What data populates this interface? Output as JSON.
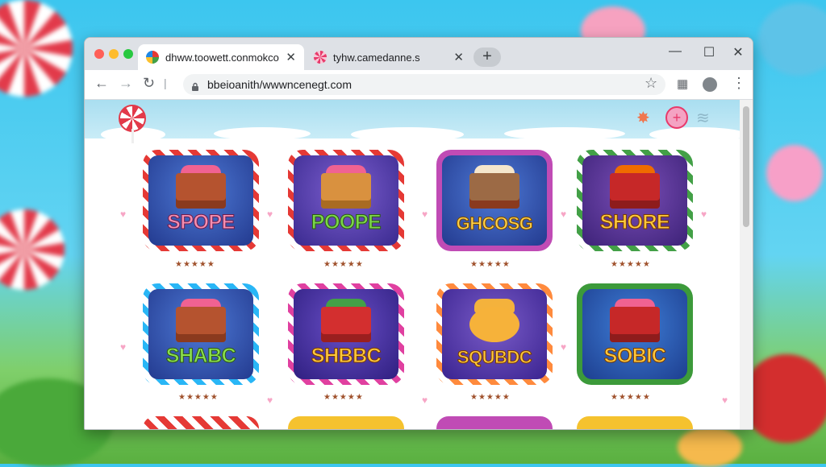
{
  "colors": {
    "accent": "#e83a6b",
    "window_frame": "#dee1e6"
  },
  "tabs": [
    {
      "title": "dhww.toowett.conmokco",
      "icon": "candy-favicon-icon",
      "active": true
    },
    {
      "title": "tyhw.camedanne.s",
      "icon": "candy-favicon-icon",
      "active": false
    }
  ],
  "new_tab_label": "+",
  "address_bar": {
    "url": "bbeioanith/wwwncenegt.com"
  },
  "games": [
    {
      "label": "SPOPE",
      "rating": "★★★★★"
    },
    {
      "label": "POOPE",
      "rating": "★★★★★"
    },
    {
      "label": "GHCOSG",
      "rating": "★★★★★"
    },
    {
      "label": "SHORE",
      "rating": "★★★★★"
    },
    {
      "label": "SHABC",
      "rating": "★★★★★"
    },
    {
      "label": "SHBBC",
      "rating": "★★★★★"
    },
    {
      "label": "SQUBDC",
      "rating": "★★★★★"
    },
    {
      "label": "SOBIC",
      "rating": "★★★★★"
    }
  ]
}
